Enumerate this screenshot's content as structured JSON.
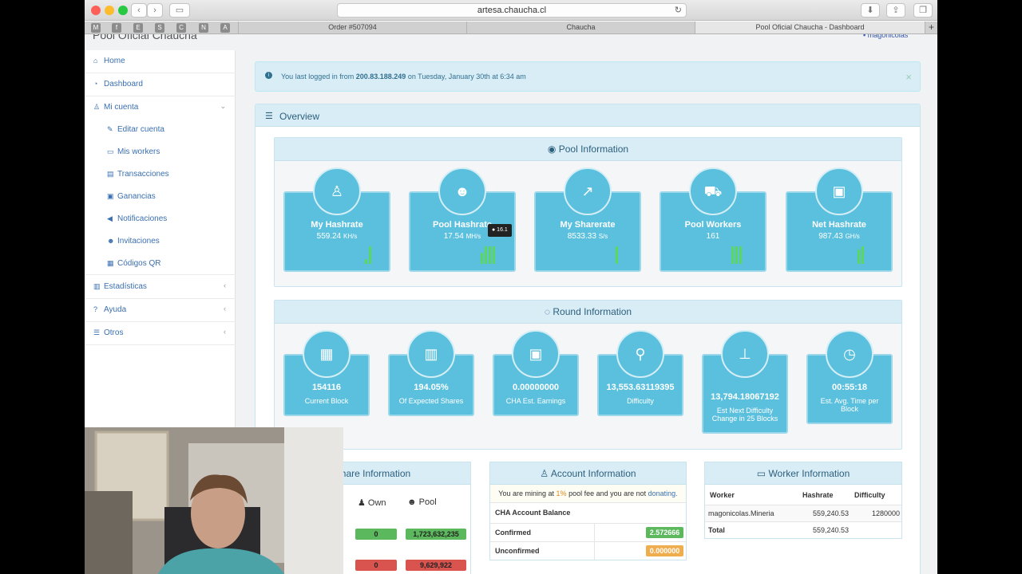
{
  "browser": {
    "url": "artesa.chaucha.cl",
    "favicons": [
      "M",
      "f",
      "E",
      "S",
      "C",
      "N",
      "A"
    ],
    "tabs": [
      "Order #507094",
      "Chaucha",
      "Pool Oficial Chaucha - Dashboard"
    ]
  },
  "header": {
    "brand": "Pool Oficial Chaucha",
    "user": "magonicolas"
  },
  "sidebar": {
    "items": [
      {
        "label": "Home",
        "icon": "home-icon"
      },
      {
        "label": "Dashboard",
        "icon": "dashboard-icon"
      },
      {
        "label": "Mi cuenta",
        "icon": "user-icon"
      }
    ],
    "subitems": [
      {
        "label": "Editar cuenta",
        "icon": "edit-icon"
      },
      {
        "label": "Mis workers",
        "icon": "desktop-icon"
      },
      {
        "label": "Transacciones",
        "icon": "credit-card-icon"
      },
      {
        "label": "Ganancias",
        "icon": "money-icon"
      },
      {
        "label": "Notificaciones",
        "icon": "bullhorn-icon"
      },
      {
        "label": "Invitaciones",
        "icon": "users-icon"
      },
      {
        "label": "Códigos QR",
        "icon": "qrcode-icon"
      }
    ],
    "bottom": [
      {
        "label": "Estadísticas",
        "icon": "bar-chart-icon"
      },
      {
        "label": "Ayuda",
        "icon": "question-icon"
      },
      {
        "label": "Otros",
        "icon": "list-icon"
      }
    ]
  },
  "alert": {
    "prefix": "You last logged in from",
    "ip": "200.83.188.249",
    "suffix": "on Tuesday, January 30th at 6:34 am"
  },
  "overview": {
    "title": "Overview"
  },
  "pool_info": {
    "title": "Pool Information",
    "tooltip": "● 16.1",
    "cards": [
      {
        "label": "My Hashrate",
        "value": "559.24",
        "unit": "KH/s",
        "icon": "male-icon"
      },
      {
        "label": "Pool Hashrate",
        "value": "17.54",
        "unit": "MH/s",
        "icon": "users-icon"
      },
      {
        "label": "My Sharerate",
        "value": "8533.33",
        "unit": "S/s",
        "icon": "share-icon"
      },
      {
        "label": "Pool Workers",
        "value": "161",
        "unit": "",
        "icon": "truck-icon"
      },
      {
        "label": "Net Hashrate",
        "value": "987.43",
        "unit": "GH/s",
        "icon": "hdd-icon"
      }
    ]
  },
  "round_info": {
    "title": "Round Information",
    "cards": [
      {
        "value": "154116",
        "label": "Current Block",
        "icon": "th-large-icon"
      },
      {
        "value": "194.05%",
        "label": "Of Expected Shares",
        "icon": "bar-chart-icon"
      },
      {
        "value": "0.00000000",
        "label": "CHA Est. Earnings",
        "icon": "money-icon"
      },
      {
        "value": "13,553.63119395",
        "label": "Difficulty",
        "icon": "map-marker-icon"
      },
      {
        "value": "13,794.18067192",
        "label": "Est Next Difficulty Change in 25 Blocks",
        "icon": "sitemap-icon"
      },
      {
        "value": "00:55:18",
        "label": "Est. Avg. Time per Block",
        "icon": "clock-icon"
      }
    ]
  },
  "share_info": {
    "title": "Share Information",
    "col_own": "Own",
    "col_pool": "Pool",
    "valid_own": "0",
    "valid_pool": "1,723,632,235",
    "invalid_own": "0",
    "invalid_pool": "9,629,922"
  },
  "account_info": {
    "title": "Account Information",
    "msg_prefix": "You are mining at",
    "fee": "1%",
    "msg_mid": "pool fee and you are not",
    "donating": "donating.",
    "balance_label": "CHA Account Balance",
    "confirmed_label": "Confirmed",
    "confirmed_value": "2.572666",
    "unconfirmed_label": "Unconfirmed",
    "unconfirmed_value": "0.000000"
  },
  "worker_info": {
    "title": "Worker Information",
    "headers": [
      "Worker",
      "Hashrate",
      "Difficulty"
    ],
    "rows": [
      [
        "magonicolas.Mineria",
        "559,240.53",
        "1280000"
      ],
      [
        "Total",
        "559,240.53",
        ""
      ]
    ]
  },
  "colors": {
    "card": "#5bc0de",
    "success": "#5cb85c",
    "danger": "#d9534f",
    "warning": "#f0ad4e",
    "info_bg": "#d9edf7"
  }
}
